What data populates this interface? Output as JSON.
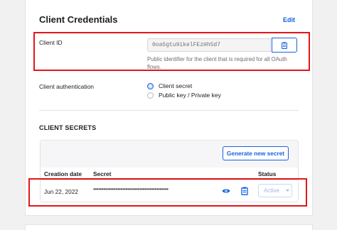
{
  "section": {
    "title": "Client Credentials",
    "edit_label": "Edit"
  },
  "client_id": {
    "label": "Client ID",
    "value": "0oa5gtu9ikelFEzHh5d7",
    "help": "Public identifier for the client that is required for all OAuth flows."
  },
  "client_auth": {
    "label": "Client authentication",
    "options": [
      {
        "label": "Client secret",
        "checked": true
      },
      {
        "label": "Public key / Private key",
        "checked": false
      }
    ]
  },
  "client_secrets": {
    "title": "CLIENT SECRETS",
    "generate_label": "Generate new secret",
    "columns": [
      "Creation date",
      "Secret",
      "Status"
    ],
    "rows": [
      {
        "date": "Jun 22, 2022",
        "secret": "••••••••••••••••••••••••••••••••••••••••••••",
        "status": "Active"
      }
    ]
  },
  "colors": {
    "accent": "#1662dd",
    "highlight": "#e3151a"
  },
  "icons": {
    "copy": "clipboard-icon",
    "reveal": "eye-icon",
    "dropdown": "chevron-down-icon"
  }
}
